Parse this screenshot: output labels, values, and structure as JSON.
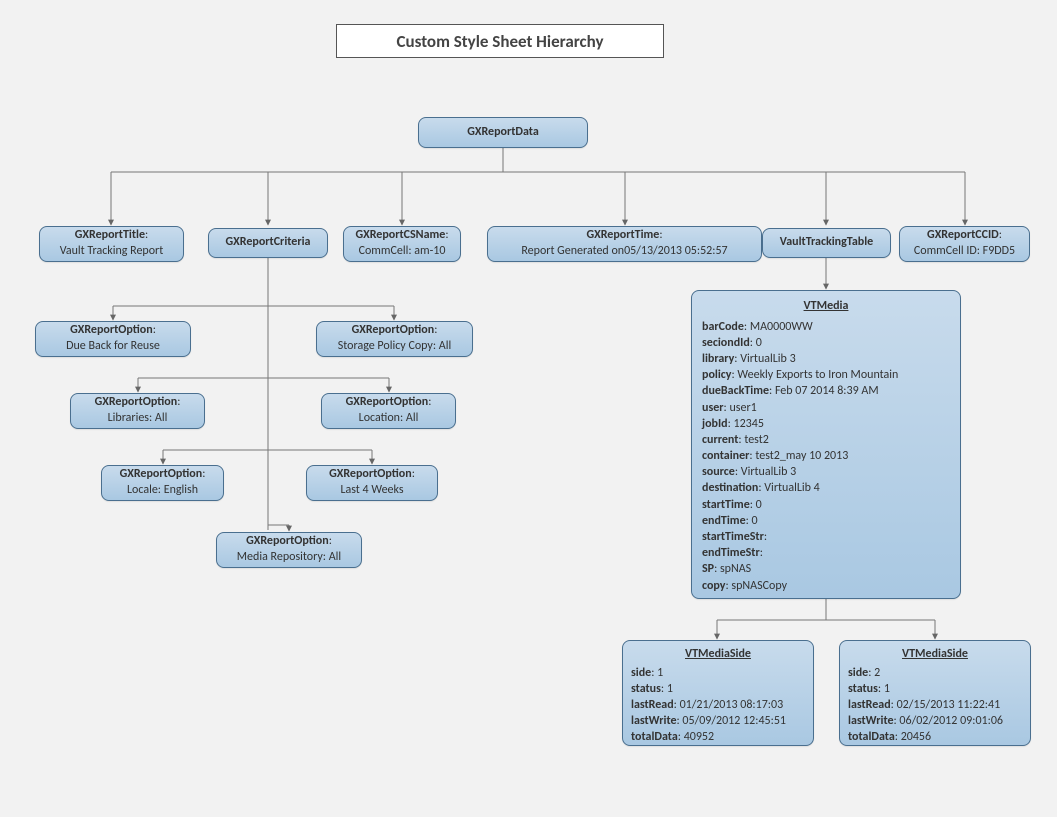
{
  "title": "Custom Style Sheet Hierarchy",
  "root": "GXReportData",
  "children": {
    "reportTitle": {
      "label": "GXReportTitle",
      "value": "Vault Tracking Report"
    },
    "reportCriteria": {
      "label": "GXReportCriteria"
    },
    "reportCSName": {
      "label": "GXReportCSName",
      "value": "CommCell: am-10"
    },
    "reportTime": {
      "label": "GXReportTime",
      "value": "Report Generated on05/13/2013 05:52:57"
    },
    "vaultTrackingTable": {
      "label": "VaultTrackingTable"
    },
    "reportCCID": {
      "label": "GXReportCCID",
      "value": "CommCell ID: F9DD5"
    }
  },
  "criteriaOptions": {
    "opt1a": {
      "label": "GXReportOption",
      "value": "Due Back for Reuse"
    },
    "opt1b": {
      "label": "GXReportOption",
      "value": "Storage Policy Copy: All"
    },
    "opt2a": {
      "label": "GXReportOption",
      "value": "Libraries: All"
    },
    "opt2b": {
      "label": "GXReportOption",
      "value": "Location: All"
    },
    "opt3a": {
      "label": "GXReportOption",
      "value": "Locale: English"
    },
    "opt3b": {
      "label": "GXReportOption",
      "value": "Last 4 Weeks"
    },
    "opt4": {
      "label": "GXReportOption",
      "value": "Media Repository: All"
    }
  },
  "vtMedia": {
    "header": "VTMedia",
    "fields": [
      {
        "k": "barCode",
        "v": "MA0000WW"
      },
      {
        "k": "seciondId",
        "v": "0"
      },
      {
        "k": "library",
        "v": "VirtualLib 3"
      },
      {
        "k": "policy",
        "v": "Weekly Exports to Iron Mountain"
      },
      {
        "k": "dueBackTime",
        "v": "Feb 07 2014 8:39 AM"
      },
      {
        "k": "user",
        "v": "user1"
      },
      {
        "k": "jobId",
        "v": "12345"
      },
      {
        "k": "current",
        "v": "test2"
      },
      {
        "k": "container",
        "v": "test2_may 10 2013"
      },
      {
        "k": "source",
        "v": "VirtualLib 3"
      },
      {
        "k": "destination",
        "v": "VirtualLib 4"
      },
      {
        "k": "startTime",
        "v": "0"
      },
      {
        "k": "endTime",
        "v": "0"
      },
      {
        "k": "startTimeStr",
        "v": ""
      },
      {
        "k": "endTimeStr",
        "v": ""
      },
      {
        "k": "SP",
        "v": "spNAS"
      },
      {
        "k": "copy",
        "v": "spNASCopy"
      }
    ]
  },
  "vtMediaSides": [
    {
      "header": "VTMediaSide",
      "fields": [
        {
          "k": "side",
          "v": "1"
        },
        {
          "k": "status",
          "v": "1"
        },
        {
          "k": "lastRead",
          "v": "01/21/2013 08:17:03"
        },
        {
          "k": "lastWrite",
          "v": "05/09/2012 12:45:51"
        },
        {
          "k": "totalData",
          "v": "40952"
        }
      ]
    },
    {
      "header": "VTMediaSide",
      "fields": [
        {
          "k": "side",
          "v": "2"
        },
        {
          "k": "status",
          "v": "1"
        },
        {
          "k": "lastRead",
          "v": "02/15/2013 11:22:41"
        },
        {
          "k": "lastWrite",
          "v": "06/02/2012 09:01:06"
        },
        {
          "k": "totalData",
          "v": "20456"
        }
      ]
    }
  ]
}
